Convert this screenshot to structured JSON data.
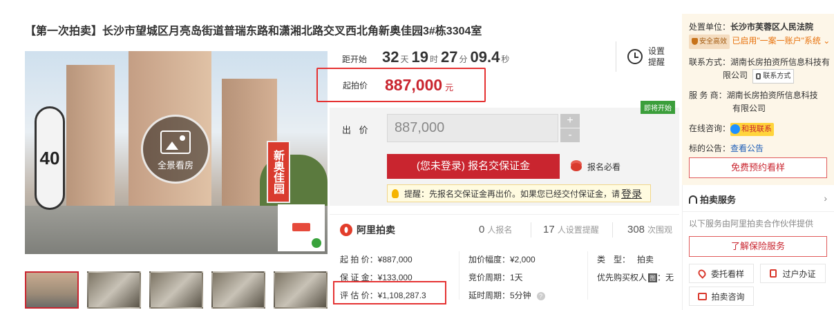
{
  "title": "【第一次拍卖】长沙市望城区月亮岛街道普瑞东路和潇湘北路交叉西北角新奥佳园3#栋3304室",
  "gallery": {
    "pano_label": "全景看房",
    "thumbnail_count": 5
  },
  "countdown": {
    "label": "距开始",
    "days": "32",
    "days_unit": "天",
    "hours": "19",
    "hours_unit": "时",
    "minutes": "27",
    "minutes_unit": "分",
    "seconds": "09.4",
    "seconds_unit": "秒"
  },
  "remind": {
    "label": "设置提醒"
  },
  "start_price": {
    "label": "起拍价",
    "value": "887,000",
    "currency": "元"
  },
  "status_tag": "即将开始",
  "bid": {
    "label": "出 价",
    "value": "887,000",
    "plus": "+",
    "minus": "-",
    "signup_button": "(您未登录) 报名交保证金",
    "must_signup": "报名必看",
    "tip_text": "提醒：先报名交保证金再出价。如果您已经交付保证金，请",
    "tip_link": "登录"
  },
  "ali": {
    "brand": "阿里拍卖",
    "signups": "0",
    "signups_unit": "人报名",
    "reminders": "17",
    "reminders_unit": "人设置提醒",
    "views": "308",
    "views_unit": "次围观"
  },
  "details": {
    "start_price": "起 拍 价：¥887,000",
    "deposit": "保 证 金：¥133,000",
    "appraisal": "评 估 价：¥1,108,287.3",
    "increment": "加价幅度：¥2,000",
    "bid_cycle": "竞价周期：1天",
    "extension": "延时周期：5分钟",
    "type_label": "类　型：",
    "type_value": "拍卖",
    "priority": "优先购买权人",
    "priority_tag": "图",
    "priority_value": "：无"
  },
  "sidebar": {
    "court_label": "处置单位：",
    "court_value": "长沙市芙蓉区人民法院",
    "safe_badge": "安全高效",
    "one_account": "已启用\"一案一账户\"系统",
    "contact_label": "联系方式：",
    "contact_value_1": "湖南长房拍资所信息科技有",
    "contact_value_2": "限公司",
    "contact_badge": "联系方式",
    "service_label": "服 务 商：",
    "service_value_1": "湖南长房拍资所信息科技",
    "service_value_2": "有限公司",
    "consult_label": "在线咨询：",
    "consult_badge": "和我联系",
    "notice_label": "标的公告：",
    "notice_link": "查看公告",
    "book_button": "免费预约看样",
    "services_title": "拍卖服务",
    "services_desc": "以下服务由阿里拍卖合作伙伴提供",
    "insurance_button": "了解保险服务",
    "entrust_button": "委托看样",
    "transfer_button": "过户办证",
    "consult_button": "拍卖咨询"
  }
}
